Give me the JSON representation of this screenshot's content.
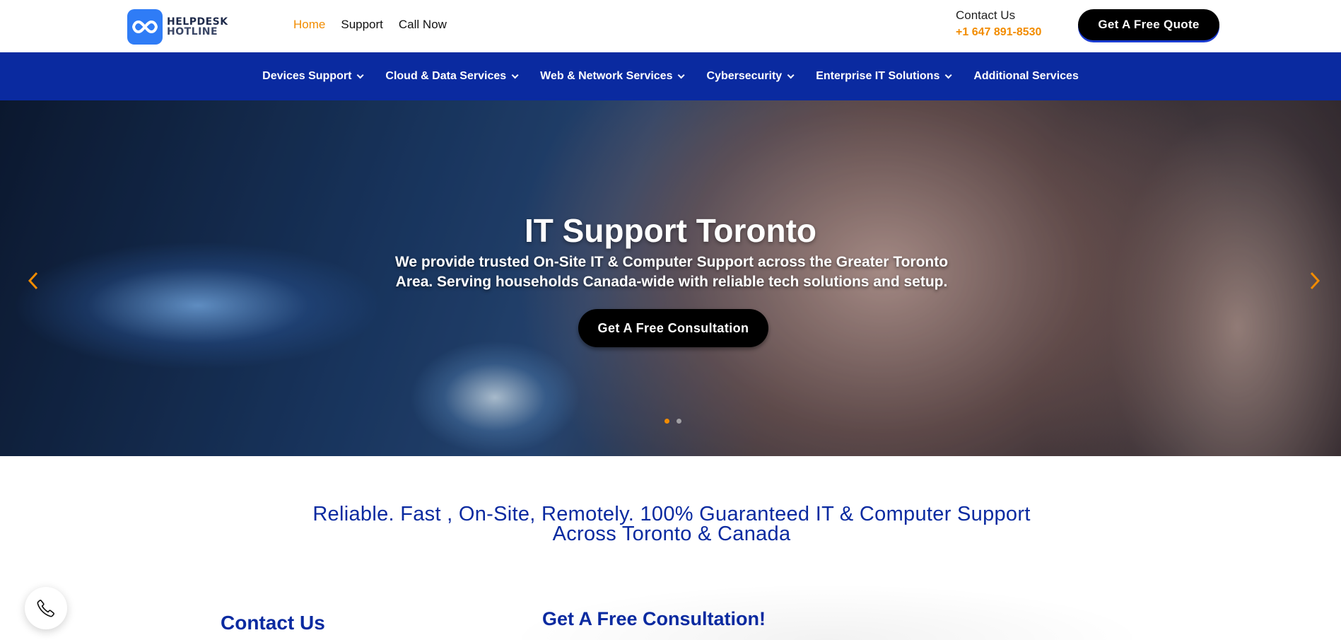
{
  "brand": {
    "name_line1": "HELPDESK",
    "name_line2": "HOTLINE",
    "logo_color": "#2f7cf6"
  },
  "top_nav": {
    "items": [
      {
        "label": "Home",
        "active": true
      },
      {
        "label": "Support",
        "active": false
      },
      {
        "label": "Call Now",
        "active": false
      }
    ]
  },
  "contact": {
    "label": "Contact Us",
    "phone": "+1 647 891-8530"
  },
  "header_cta": "Get A Free Quote",
  "main_nav": {
    "items": [
      {
        "label": "Devices Support",
        "has_dropdown": true
      },
      {
        "label": "Cloud & Data Services",
        "has_dropdown": true
      },
      {
        "label": "Web & Network Services",
        "has_dropdown": true
      },
      {
        "label": "Cybersecurity",
        "has_dropdown": true
      },
      {
        "label": "Enterprise IT Solutions",
        "has_dropdown": true
      },
      {
        "label": "Additional Services",
        "has_dropdown": false
      }
    ]
  },
  "hero": {
    "title": "IT Support Toronto",
    "subtitle": "We provide trusted On-Site IT & Computer Support across the Greater Toronto Area. Serving households Canada-wide with reliable tech solutions and setup.",
    "cta": "Get A Free Consultation",
    "slides_total": 2,
    "active_slide": 1
  },
  "tagline": {
    "line1": "Reliable. Fast , On-Site, Remotely. 100% Guaranteed IT & Computer Support",
    "line2": "Across Toronto & Canada"
  },
  "sections": {
    "contact_heading": "Contact Us",
    "consultation_heading": "Get A Free Consultation!"
  },
  "icons": {
    "logo": "infinity-icon",
    "arrows": [
      "chevron-left-icon",
      "chevron-right-icon"
    ],
    "call": "phone-icon"
  },
  "colors": {
    "accent_orange": "#f28c00",
    "nav_blue": "#0a2aa0",
    "button_black": "#000000"
  }
}
